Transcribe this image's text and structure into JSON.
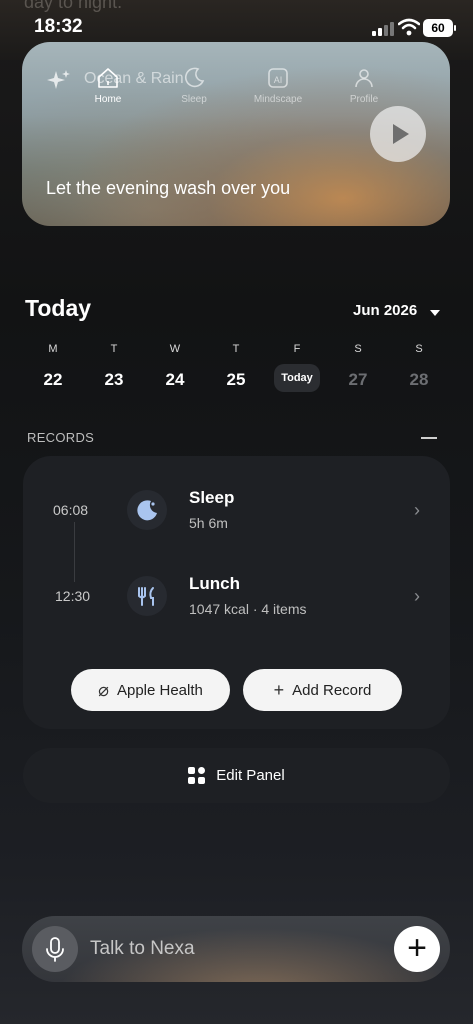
{
  "status_bar": {
    "time": "18:32",
    "battery": "60"
  },
  "background_text": "day to night.",
  "hero": {
    "ghost_title": "Ocean & Rain",
    "tagline": "Let the evening wash over you",
    "nav": [
      {
        "label": "Home",
        "icon": "home-icon",
        "active": true
      },
      {
        "label": "Sleep",
        "icon": "moon-icon",
        "active": false
      },
      {
        "label": "Mindscape",
        "icon": "ai-icon",
        "active": false
      },
      {
        "label": "Profile",
        "icon": "person-icon",
        "active": false
      }
    ]
  },
  "calendar": {
    "title": "Today",
    "month": "Jun 2026",
    "days": [
      {
        "dow": "M",
        "num": "22",
        "state": "past"
      },
      {
        "dow": "T",
        "num": "23",
        "state": "past"
      },
      {
        "dow": "W",
        "num": "24",
        "state": "past"
      },
      {
        "dow": "T",
        "num": "25",
        "state": "past"
      },
      {
        "dow": "F",
        "num": "Today",
        "state": "today"
      },
      {
        "dow": "S",
        "num": "27",
        "state": "future"
      },
      {
        "dow": "S",
        "num": "28",
        "state": "future"
      }
    ]
  },
  "records": {
    "label": "RECORDS",
    "items": [
      {
        "time": "06:08",
        "title": "Sleep",
        "subtitle": "5h 6m",
        "icon": "moon-icon"
      },
      {
        "time": "12:30",
        "title": "Lunch",
        "subtitle": "1047 kcal · 4 items",
        "icon": "fork-knife-icon"
      }
    ],
    "apple_health_label": "Apple Health",
    "add_record_label": "Add Record"
  },
  "edit_panel_label": "Edit Panel",
  "talk": {
    "placeholder": "Talk to Nexa"
  }
}
